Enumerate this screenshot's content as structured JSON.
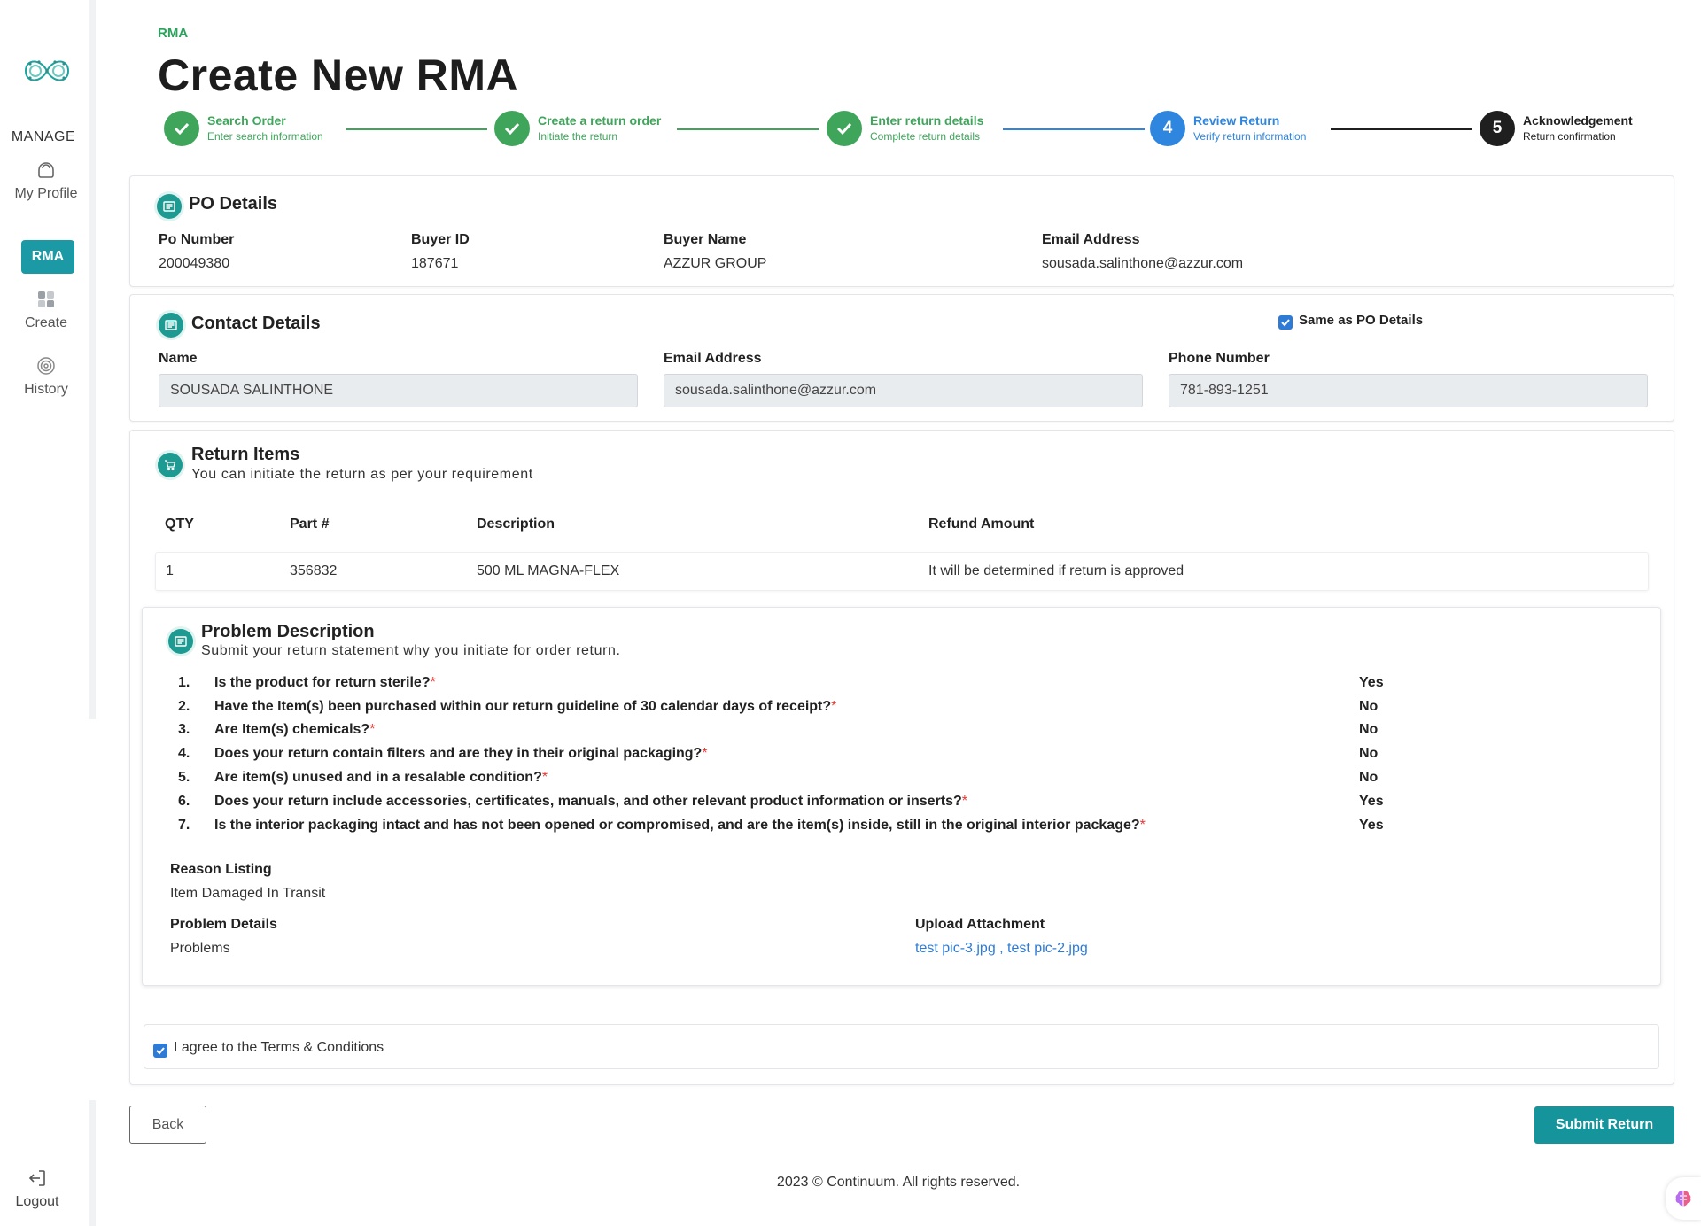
{
  "sidebar": {
    "section_label": "MANAGE",
    "items": [
      {
        "label": "My Profile",
        "icon": "profile-icon"
      },
      {
        "label": "RMA"
      },
      {
        "label": "Create",
        "icon": "grid-icon"
      },
      {
        "label": "History",
        "icon": "history-icon"
      }
    ],
    "logout_label": "Logout"
  },
  "header": {
    "breadcrumb": "RMA",
    "title": "Create New RMA"
  },
  "stepper": [
    {
      "number": "1",
      "title": "Search Order",
      "subtitle": "Enter search information",
      "state": "done"
    },
    {
      "number": "2",
      "title": "Create a return order",
      "subtitle": "Initiate the return",
      "state": "done"
    },
    {
      "number": "3",
      "title": "Enter return details",
      "subtitle": "Complete return details",
      "state": "done"
    },
    {
      "number": "4",
      "title": "Review Return",
      "subtitle": "Verify return information",
      "state": "active"
    },
    {
      "number": "5",
      "title": "Acknowledgement",
      "subtitle": "Return confirmation",
      "state": "pending"
    }
  ],
  "po_details": {
    "title": "PO Details",
    "fields": [
      {
        "label": "Po Number",
        "value": "200049380"
      },
      {
        "label": "Buyer ID",
        "value": "187671"
      },
      {
        "label": "Buyer Name",
        "value": "AZZUR GROUP"
      },
      {
        "label": "Email Address",
        "value": "sousada.salinthone@azzur.com"
      }
    ]
  },
  "contact_details": {
    "title": "Contact Details",
    "same_as_po_label": "Same as PO Details",
    "same_as_po_checked": true,
    "fields": [
      {
        "label": "Name",
        "value": "SOUSADA SALINTHONE"
      },
      {
        "label": "Email Address",
        "value": "sousada.salinthone@azzur.com"
      },
      {
        "label": "Phone Number",
        "value": "781-893-1251"
      }
    ]
  },
  "return_items": {
    "title": "Return Items",
    "subtitle": "You can initiate the return as per your requirement",
    "columns": [
      "QTY",
      "Part #",
      "Description",
      "Refund Amount"
    ],
    "rows": [
      {
        "qty": "1",
        "part": "356832",
        "description": "500 ML MAGNA-FLEX",
        "refund": "It will be determined if return is approved"
      }
    ]
  },
  "problem": {
    "title": "Problem Description",
    "subtitle": "Submit your return statement why you initiate for order return.",
    "questions": [
      {
        "num": "1.",
        "text": "Is the product for return sterile?",
        "required": "*",
        "answer": "Yes"
      },
      {
        "num": "2.",
        "text": "Have the Item(s) been purchased within our return guideline of 30 calendar days of receipt?",
        "required": "*",
        "answer": "No"
      },
      {
        "num": "3.",
        "text": "Are Item(s) chemicals?",
        "required": "*",
        "answer": "No"
      },
      {
        "num": "4.",
        "text": "Does your return contain filters and are they in their original packaging?",
        "required": "*",
        "answer": "No"
      },
      {
        "num": "5.",
        "text": "Are item(s) unused and in a resalable condition?",
        "required": "*",
        "answer": "No"
      },
      {
        "num": "6.",
        "text": "Does your return include accessories, certificates, manuals, and other relevant product information or inserts?",
        "required": "*",
        "answer": "Yes"
      },
      {
        "num": "7.",
        "text": "Is the interior packaging intact and has not been opened or compromised, and are the item(s) inside, still in the original interior package?",
        "required": "*",
        "answer": "Yes"
      }
    ],
    "reason_label": "Reason Listing",
    "reason_value": "Item Damaged In Transit",
    "details_label": "Problem Details",
    "details_value": "Problems",
    "attachment_label": "Upload Attachment",
    "attachment_value": "test pic-3.jpg , test pic-2.jpg"
  },
  "terms": {
    "label": "I agree to the Terms & Conditions",
    "checked": true
  },
  "actions": {
    "back_label": "Back",
    "submit_label": "Submit Return"
  },
  "footer": "2023 © Continuum. All rights reserved.",
  "colors": {
    "accent": "#1b9aa5",
    "step_done": "#3ea55b",
    "step_active": "#2e86de",
    "step_pending": "#1f1f1f",
    "required": "#e53935"
  }
}
